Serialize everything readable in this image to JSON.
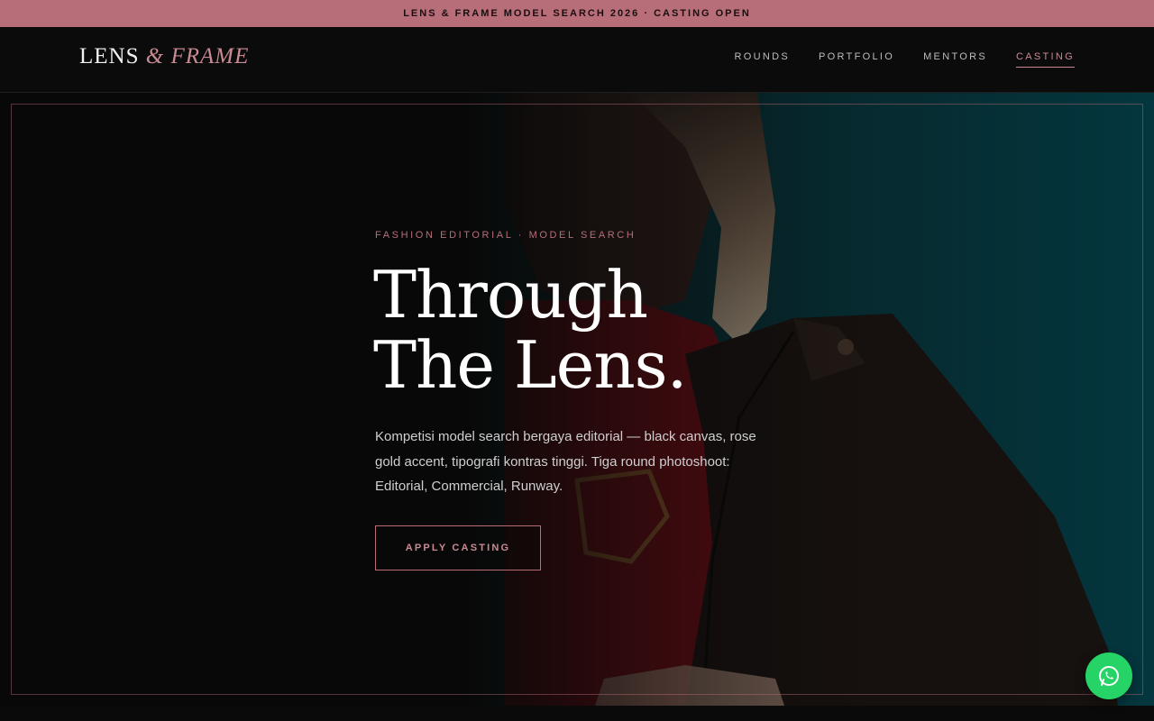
{
  "announcement": "LENS & FRAME MODEL SEARCH 2026 · CASTING OPEN",
  "brand": {
    "main": "LENS",
    "accent": "& FRAME"
  },
  "nav": {
    "items": [
      {
        "label": "ROUNDS"
      },
      {
        "label": "PORTFOLIO"
      },
      {
        "label": "MENTORS"
      },
      {
        "label": "CASTING",
        "active": true
      }
    ]
  },
  "hero": {
    "eyebrow": "FASHION EDITORIAL · MODEL SEARCH",
    "headline_line1": "Through",
    "headline_line2": "The Lens.",
    "lead": "Kompetisi model search bergaya editorial — black canvas, rose gold accent, tipografi kontras tinggi. Tiga round photoshoot: Editorial, Commercial, Runway.",
    "cta_label": "APPLY CASTING"
  },
  "floating": {
    "icon": "whatsapp-icon"
  },
  "colors": {
    "accent": "#b76e79",
    "background": "#0a0a0a",
    "whatsapp": "#25d366"
  }
}
